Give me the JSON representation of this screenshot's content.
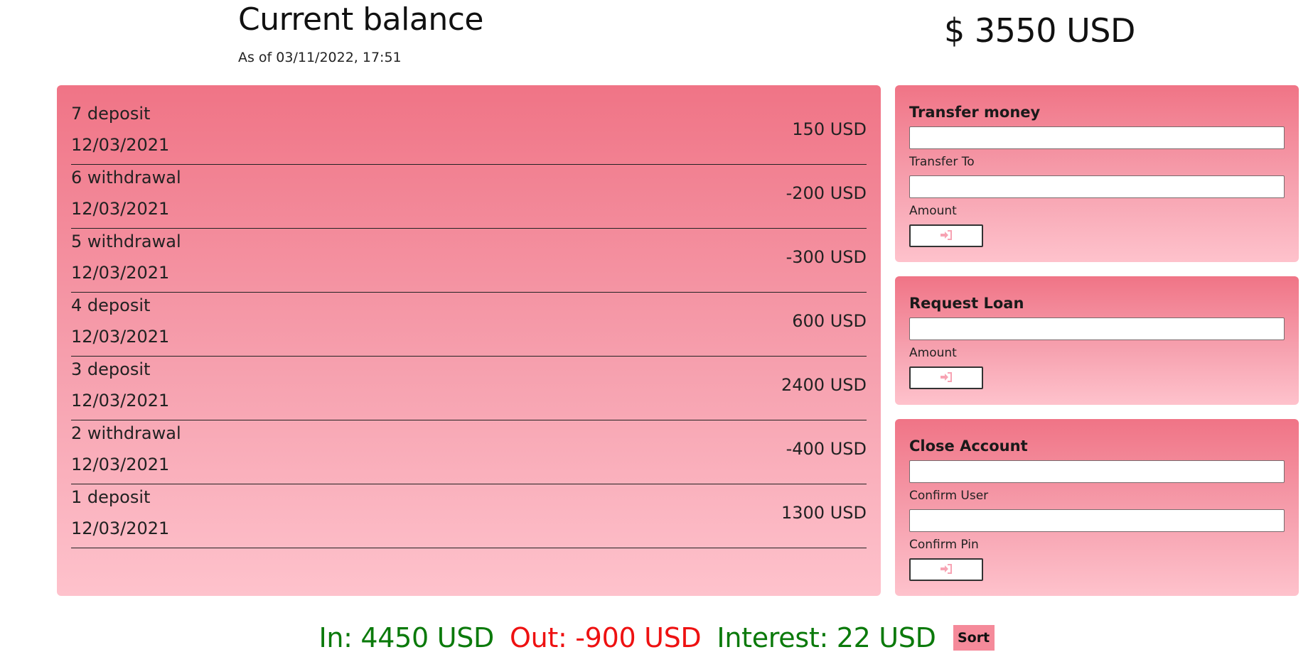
{
  "header": {
    "title": "Current balance",
    "date_text": "As of 03/11/2022, 17:51",
    "balance": "$ 3550 USD"
  },
  "movements": [
    {
      "type": "7 deposit",
      "date": "12/03/2021",
      "value": "150 USD"
    },
    {
      "type": "6 withdrawal",
      "date": "12/03/2021",
      "value": "-200 USD"
    },
    {
      "type": "5 withdrawal",
      "date": "12/03/2021",
      "value": "-300 USD"
    },
    {
      "type": "4 deposit",
      "date": "12/03/2021",
      "value": "600 USD"
    },
    {
      "type": "3 deposit",
      "date": "12/03/2021",
      "value": "2400 USD"
    },
    {
      "type": "2 withdrawal",
      "date": "12/03/2021",
      "value": "-400 USD"
    },
    {
      "type": "1 deposit",
      "date": "12/03/2021",
      "value": "1300 USD"
    }
  ],
  "operations": {
    "transfer": {
      "title": "Transfer money",
      "to_label": "Transfer To",
      "to_value": "",
      "amount_label": "Amount",
      "amount_value": "",
      "button_icon": "login-arrow-icon"
    },
    "loan": {
      "title": "Request Loan",
      "amount_label": "Amount",
      "amount_value": "",
      "button_icon": "login-arrow-icon"
    },
    "close": {
      "title": "Close Account",
      "user_label": "Confirm User",
      "user_value": "",
      "pin_label": "Confirm Pin",
      "pin_value": "",
      "button_icon": "login-arrow-icon"
    }
  },
  "summary": {
    "in": "In: 4450 USD",
    "out": "Out: -900 USD",
    "interest": "Interest: 22 USD",
    "sort_label": "Sort"
  },
  "colors": {
    "panel_top": "#f07486",
    "panel_bottom": "#fec2cc",
    "positive": "#0b7a0b",
    "negative": "#ee1111",
    "sort_button": "#f58a9a",
    "icon_pink": "#f7a3b3"
  }
}
